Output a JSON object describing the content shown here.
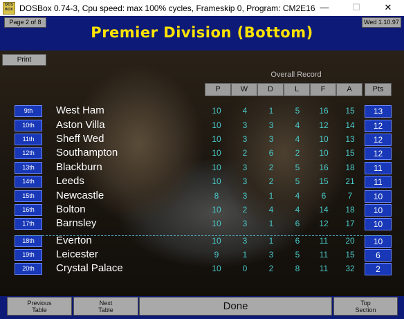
{
  "window": {
    "title": "DOSBox 0.74-3, Cpu speed: max 100% cycles, Frameskip  0, Program:   CM2E16",
    "icon_text": "DOS BOX",
    "controls": {
      "minimize": "—",
      "maximize": "☐",
      "close": "✕"
    }
  },
  "header": {
    "page_indicator": "Page 2 of 8",
    "title": "Premier Division (Bottom)",
    "date": "Wed 1.10.97"
  },
  "print_label": "Print",
  "table": {
    "group_label": "Overall Record",
    "columns": [
      "P",
      "W",
      "D",
      "L",
      "F",
      "A",
      "Pts"
    ],
    "rows": [
      {
        "pos": "9th",
        "team": "West Ham",
        "p": "10",
        "w": "4",
        "d": "1",
        "l": "5",
        "f": "16",
        "a": "15",
        "pts": "13"
      },
      {
        "pos": "10th",
        "team": "Aston Villa",
        "p": "10",
        "w": "3",
        "d": "3",
        "l": "4",
        "f": "12",
        "a": "14",
        "pts": "12"
      },
      {
        "pos": "11th",
        "team": "Sheff Wed",
        "p": "10",
        "w": "3",
        "d": "3",
        "l": "4",
        "f": "10",
        "a": "13",
        "pts": "12"
      },
      {
        "pos": "12th",
        "team": "Southampton",
        "p": "10",
        "w": "2",
        "d": "6",
        "l": "2",
        "f": "10",
        "a": "15",
        "pts": "12"
      },
      {
        "pos": "13th",
        "team": "Blackburn",
        "p": "10",
        "w": "3",
        "d": "2",
        "l": "5",
        "f": "16",
        "a": "18",
        "pts": "11"
      },
      {
        "pos": "14th",
        "team": "Leeds",
        "p": "10",
        "w": "3",
        "d": "2",
        "l": "5",
        "f": "15",
        "a": "21",
        "pts": "11"
      },
      {
        "pos": "15th",
        "team": "Newcastle",
        "p": "8",
        "w": "3",
        "d": "1",
        "l": "4",
        "f": "6",
        "a": "7",
        "pts": "10"
      },
      {
        "pos": "16th",
        "team": "Bolton",
        "p": "10",
        "w": "2",
        "d": "4",
        "l": "4",
        "f": "14",
        "a": "18",
        "pts": "10"
      },
      {
        "pos": "17th",
        "team": "Barnsley",
        "p": "10",
        "w": "3",
        "d": "1",
        "l": "6",
        "f": "12",
        "a": "17",
        "pts": "10"
      },
      {
        "pos": "18th",
        "team": "Everton",
        "p": "10",
        "w": "3",
        "d": "1",
        "l": "6",
        "f": "11",
        "a": "20",
        "pts": "10"
      },
      {
        "pos": "19th",
        "team": "Leicester",
        "p": "9",
        "w": "1",
        "d": "3",
        "l": "5",
        "f": "11",
        "a": "15",
        "pts": "6"
      },
      {
        "pos": "20th",
        "team": "Crystal Palace",
        "p": "10",
        "w": "0",
        "d": "2",
        "l": "8",
        "f": "11",
        "a": "32",
        "pts": "2"
      }
    ]
  },
  "footer": {
    "previous_line1": "Previous",
    "previous_line2": "Table",
    "next_line1": "Next",
    "next_line2": "Table",
    "done": "Done",
    "top_line1": "Top",
    "top_line2": "Section"
  },
  "colors": {
    "title_yellow": "#ffe400",
    "bar_blue": "#0e1a78",
    "badge_blue": "#1838b8",
    "stat_cyan": "#49c9c9"
  }
}
